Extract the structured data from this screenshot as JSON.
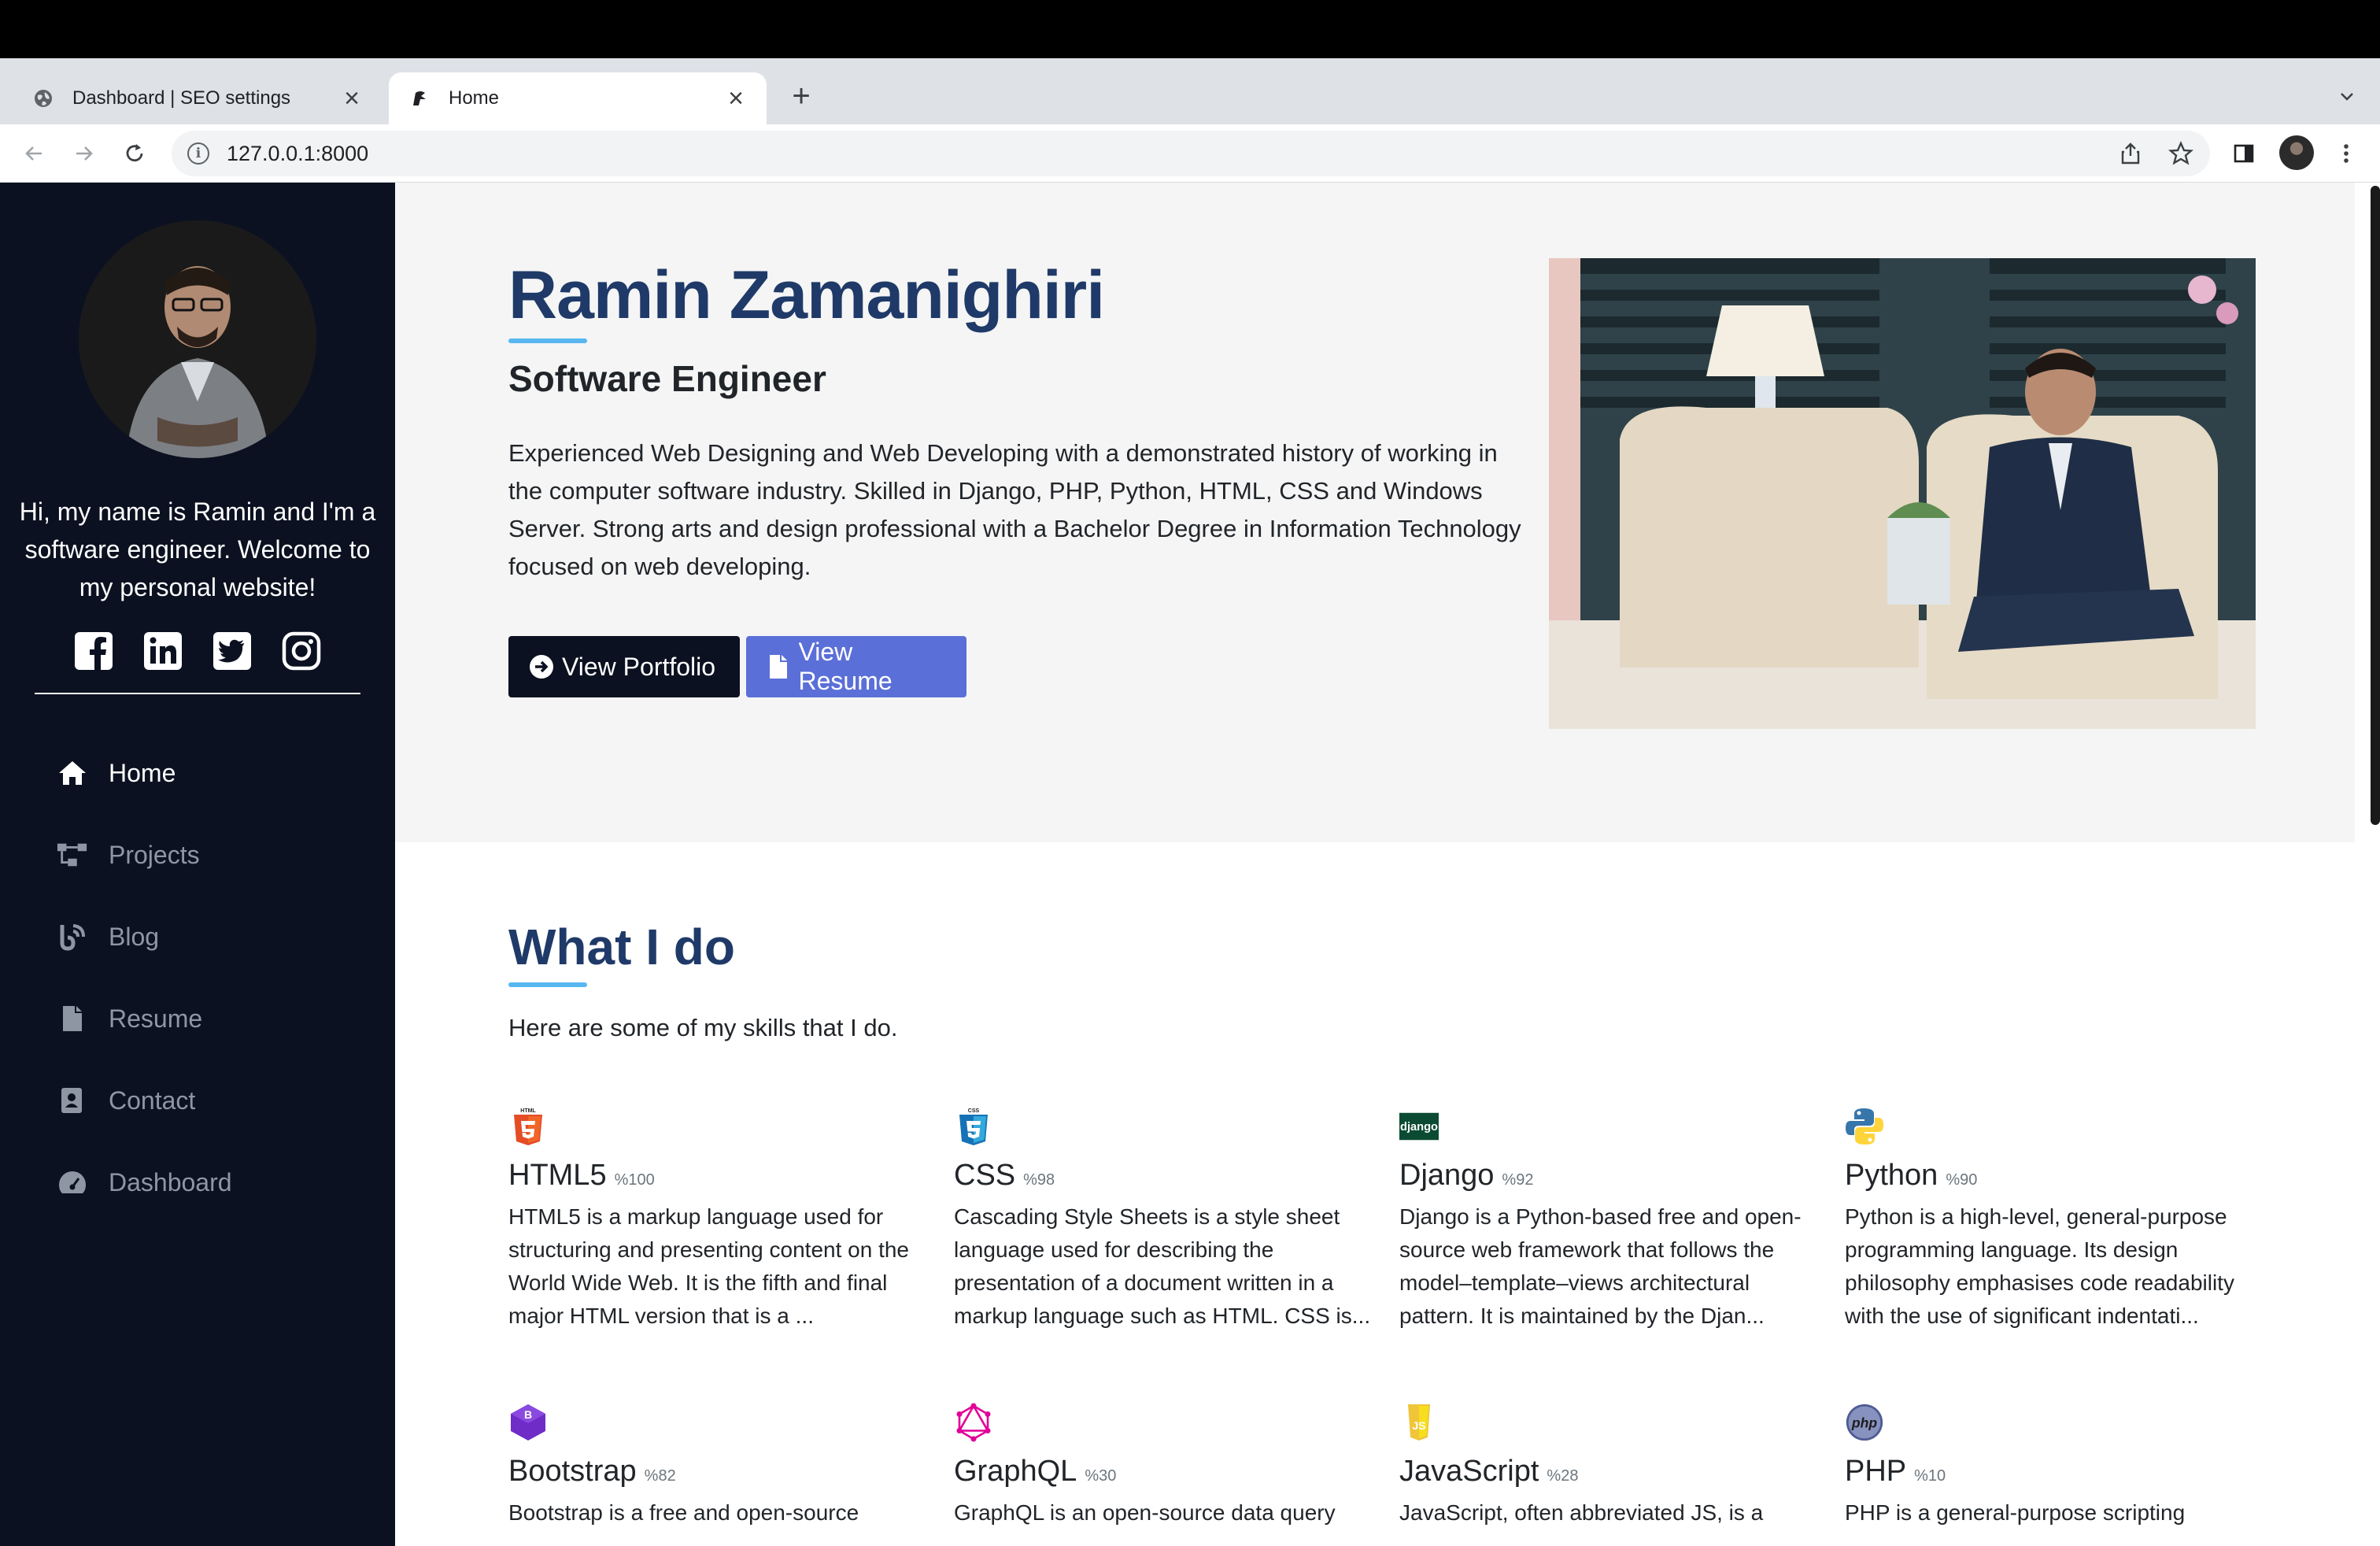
{
  "browser": {
    "tabs": [
      {
        "title": "Dashboard | SEO settings",
        "active": false
      },
      {
        "title": "Home",
        "active": true
      }
    ],
    "url": "127.0.0.1:8000"
  },
  "sidebar": {
    "bio": "Hi, my name is Ramin and I'm a software engineer. Welcome to my personal website!",
    "social": [
      "facebook-icon",
      "linkedin-icon",
      "twitter-icon",
      "instagram-icon"
    ],
    "nav": [
      {
        "label": "Home",
        "icon": "home-icon",
        "active": true
      },
      {
        "label": "Projects",
        "icon": "sitemap-icon",
        "active": false
      },
      {
        "label": "Blog",
        "icon": "blog-icon",
        "active": false
      },
      {
        "label": "Resume",
        "icon": "file-icon",
        "active": false
      },
      {
        "label": "Contact",
        "icon": "address-book-icon",
        "active": false
      },
      {
        "label": "Dashboard",
        "icon": "gauge-icon",
        "active": false
      }
    ]
  },
  "hero": {
    "name": "Ramin Zamanighiri",
    "job_title": "Software Engineer",
    "intro": "Experienced Web Designing and Web Developing with a demonstrated history of working in the computer software industry. Skilled in Django, PHP, Python, HTML, CSS and Windows Server. Strong arts and design professional with a Bachelor Degree in Information Technology focused on web developing.",
    "portfolio_button": "View Portfolio",
    "resume_button": "View Resume"
  },
  "skills_section": {
    "title": "What I do",
    "subtitle": "Here are some of my skills that I do.",
    "skills": [
      {
        "name": "HTML5",
        "percent": "%100",
        "icon": "html5-icon",
        "desc": "HTML5 is a markup language used for structuring and presenting content on the World Wide Web. It is the fifth and final major HTML version that is a ..."
      },
      {
        "name": "CSS",
        "percent": "%98",
        "icon": "css3-icon",
        "desc": "Cascading Style Sheets is a style sheet language used for describing the presentation of a document written in a markup language such as HTML. CSS is..."
      },
      {
        "name": "Django",
        "percent": "%92",
        "icon": "django-icon",
        "desc": "Django is a Python-based free and open-source web framework that follows the model–template–views architectural pattern. It is maintained by the Djan..."
      },
      {
        "name": "Python",
        "percent": "%90",
        "icon": "python-icon",
        "desc": "Python is a high-level, general-purpose programming language. Its design philosophy emphasises code readability with the use of significant indentati..."
      },
      {
        "name": "Bootstrap",
        "percent": "%82",
        "icon": "bootstrap-icon",
        "desc": "Bootstrap is a free and open-source"
      },
      {
        "name": "GraphQL",
        "percent": "%30",
        "icon": "graphql-icon",
        "desc": "GraphQL is an open-source data query"
      },
      {
        "name": "JavaScript",
        "percent": "%28",
        "icon": "javascript-icon",
        "desc": "JavaScript, often abbreviated JS, is a"
      },
      {
        "name": "PHP",
        "percent": "%10",
        "icon": "php-icon",
        "desc": "PHP is a general-purpose scripting"
      }
    ]
  },
  "icon_text": {
    "html5": "HTML",
    "css": "CSS",
    "django": "django",
    "bootstrap": "B",
    "javascript": "JS",
    "php": "php"
  },
  "colors": {
    "sidebar_bg": "#0b1120",
    "accent_navy": "#1f3a68",
    "accent_line": "#58b7f0",
    "resume_button": "#5b6fd8",
    "hero_bg": "#f5f5f5"
  }
}
